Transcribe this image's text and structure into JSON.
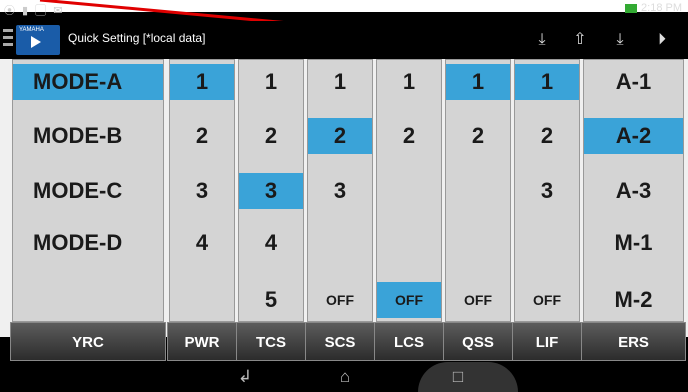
{
  "status": {
    "time": "2:18 PM",
    "left_icons": "⦿ ▮ ▢ ✉"
  },
  "app": {
    "title": "Quick Setting [*local data]",
    "logo_text": "YAMAHA"
  },
  "toolbar": [
    {
      "name": "download-icon",
      "glyph": "⤓"
    },
    {
      "name": "upload-icon",
      "glyph": "⇧"
    },
    {
      "name": "save-icon",
      "glyph": "⤓"
    },
    {
      "name": "play-icon",
      "glyph": "⏵"
    }
  ],
  "columns": [
    {
      "id": "yrc",
      "label": "YRC",
      "items": [
        "MODE-A",
        "MODE-B",
        "MODE-C",
        "MODE-D"
      ],
      "selected": 0
    },
    {
      "id": "pwr",
      "label": "PWR",
      "items": [
        "1",
        "2",
        "3",
        "4"
      ],
      "selected": 0
    },
    {
      "id": "tcs",
      "label": "TCS",
      "items": [
        "1",
        "2",
        "3",
        "4",
        "5"
      ],
      "selected": 2
    },
    {
      "id": "scs",
      "label": "SCS",
      "items": [
        "1",
        "2",
        "3",
        "",
        "OFF"
      ],
      "selected": 1
    },
    {
      "id": "lcs",
      "label": "LCS",
      "items": [
        "1",
        "2",
        "",
        "",
        "OFF"
      ],
      "selected": 4
    },
    {
      "id": "qss",
      "label": "QSS",
      "items": [
        "1",
        "2",
        "",
        "",
        "OFF"
      ],
      "selected": 0
    },
    {
      "id": "lif",
      "label": "LIF",
      "items": [
        "1",
        "2",
        "3",
        "",
        "OFF"
      ],
      "selected": 0
    },
    {
      "id": "ers",
      "label": "ERS",
      "items": [
        "A-1",
        "A-2",
        "A-3",
        "M-1",
        "M-2"
      ],
      "selected": 1
    }
  ],
  "nav": {
    "back": "↲",
    "home": "⌂",
    "recent": "□"
  },
  "colors": {
    "selected": "#3aa3d8",
    "annotation": "#e00000"
  }
}
